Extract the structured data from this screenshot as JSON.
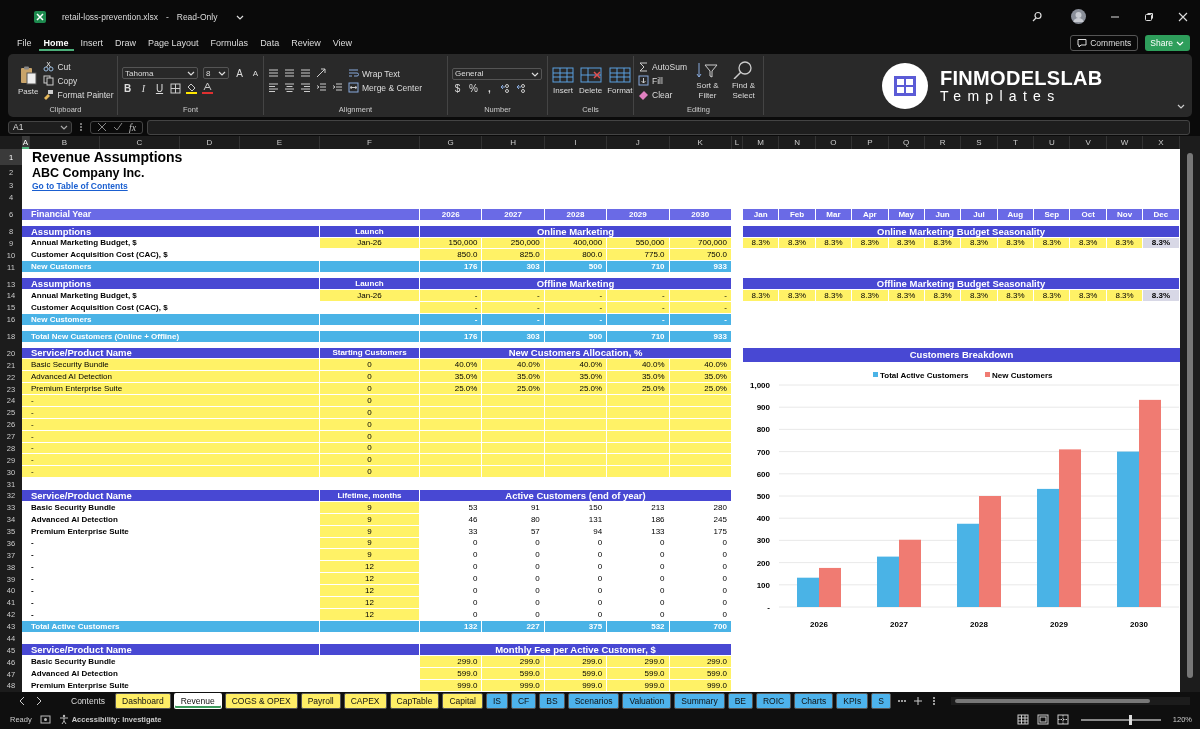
{
  "title_bar": {
    "file": "retail-loss-prevention.xlsx",
    "separator": "-",
    "status": "Read-Only"
  },
  "menu_tabs": [
    {
      "label": "File",
      "selected": false
    },
    {
      "label": "Home",
      "selected": true
    },
    {
      "label": "Insert",
      "selected": false
    },
    {
      "label": "Draw",
      "selected": false
    },
    {
      "label": "Page Layout",
      "selected": false
    },
    {
      "label": "Formulas",
      "selected": false
    },
    {
      "label": "Data",
      "selected": false
    },
    {
      "label": "Review",
      "selected": false
    },
    {
      "label": "View",
      "selected": false
    }
  ],
  "actions": {
    "comments": "Comments",
    "share": "Share"
  },
  "ribbon": {
    "clipboard": {
      "label": "Clipboard",
      "paste": "Paste",
      "cut": "Cut",
      "copy": "Copy",
      "format_painter": "Format Painter"
    },
    "font": {
      "label": "Font",
      "family": "Tahoma",
      "size": "8",
      "grow": "A",
      "shrink": "A",
      "bold": "B",
      "italic": "I",
      "underline": "U"
    },
    "alignment": {
      "label": "Alignment",
      "wrap": "Wrap Text",
      "merge": "Merge & Center"
    },
    "number": {
      "label": "Number",
      "format": "General",
      "currency": "$",
      "percent": "%",
      "comma": ","
    },
    "cells": {
      "label": "Cells",
      "insert": "Insert",
      "delete": "Delete",
      "format": "Format"
    },
    "editing": {
      "label": "Editing",
      "autosum": "AutoSum",
      "fill": "Fill",
      "clear": "Clear",
      "sort": "Sort & Filter",
      "find": "Find & Select"
    },
    "logo": {
      "name": "FINMODELSLAB",
      "tagline": "Templates"
    }
  },
  "formula_bar": {
    "name_box": "A1",
    "fx": "fx"
  },
  "columns": [
    {
      "label": "A",
      "selected": true
    },
    {
      "label": "B",
      "selected": false
    },
    {
      "label": "C",
      "selected": false
    },
    {
      "label": "D",
      "selected": false
    },
    {
      "label": "E",
      "selected": false
    },
    {
      "label": "F",
      "selected": false
    },
    {
      "label": "G",
      "selected": false
    },
    {
      "label": "H",
      "selected": false
    },
    {
      "label": "I",
      "selected": false
    },
    {
      "label": "J",
      "selected": false
    },
    {
      "label": "K",
      "selected": false
    },
    {
      "label": "L",
      "selected": false
    },
    {
      "label": "M",
      "selected": false
    },
    {
      "label": "N",
      "selected": false
    },
    {
      "label": "O",
      "selected": false
    },
    {
      "label": "P",
      "selected": false
    },
    {
      "label": "Q",
      "selected": false
    },
    {
      "label": "R",
      "selected": false
    },
    {
      "label": "S",
      "selected": false
    },
    {
      "label": "T",
      "selected": false
    },
    {
      "label": "U",
      "selected": false
    },
    {
      "label": "V",
      "selected": false
    },
    {
      "label": "W",
      "selected": false
    },
    {
      "label": "X",
      "selected": false
    }
  ],
  "rows": [
    {
      "n": "1",
      "kind": "title",
      "label": "Revenue Assumptions"
    },
    {
      "n": "2",
      "kind": "subtitle",
      "label": "ABC Company Inc."
    },
    {
      "n": "3",
      "kind": "link",
      "label": "Go to Table of Contents"
    },
    {
      "n": "4",
      "kind": "blank"
    },
    {
      "kind": "spacer"
    },
    {
      "n": "6",
      "kind": "band",
      "label": "Financial Year",
      "years": [
        "2026",
        "2027",
        "2028",
        "2029",
        "2030"
      ],
      "right": {
        "kind": "month-header",
        "values": [
          "Jan",
          "Feb",
          "Mar",
          "Apr",
          "May",
          "Jun",
          "Jul",
          "Aug",
          "Sep",
          "Oct",
          "Nov",
          "Dec"
        ]
      }
    },
    {
      "kind": "spacer"
    },
    {
      "n": "8",
      "kind": "section",
      "label": "Assumptions",
      "f": "Launch",
      "span": "Online Marketing",
      "right": {
        "kind": "header",
        "text": "Online Marketing Budget Seasonality"
      }
    },
    {
      "n": "9",
      "kind": "inputs",
      "label": "Annual Marketing Budget, $",
      "f": "Jan-26",
      "years": [
        "150,000",
        "250,000",
        "400,000",
        "550,000",
        "700,000"
      ],
      "right": {
        "kind": "seasonality",
        "inputs": [
          "8.3%",
          "8.3%",
          "8.3%",
          "8.3%",
          "8.3%",
          "8.3%",
          "8.3%",
          "8.3%",
          "8.3%",
          "8.3%",
          "8.3%"
        ],
        "balance": "8.3%"
      }
    },
    {
      "n": "10",
      "kind": "inputs",
      "label": "Customer Acquisition Cost (CAC), $",
      "years": [
        "850.0",
        "825.0",
        "800.0",
        "775.0",
        "750.0"
      ]
    },
    {
      "n": "11",
      "kind": "total",
      "label": "New Customers",
      "years": [
        "176",
        "303",
        "500",
        "710",
        "933"
      ]
    },
    {
      "kind": "spacer"
    },
    {
      "n": "13",
      "kind": "section",
      "label": "Assumptions",
      "f": "Launch",
      "span": "Offline Marketing",
      "right": {
        "kind": "header",
        "text": "Offline Marketing Budget Seasonality"
      }
    },
    {
      "n": "14",
      "kind": "inputs",
      "label": "Annual Marketing Budget, $",
      "f": "Jan-26",
      "years": [
        "-",
        "-",
        "-",
        "-",
        "-"
      ],
      "right": {
        "kind": "seasonality",
        "inputs": [
          "8.3%",
          "8.3%",
          "8.3%",
          "8.3%",
          "8.3%",
          "8.3%",
          "8.3%",
          "8.3%",
          "8.3%",
          "8.3%",
          "8.3%"
        ],
        "balance": "8.3%"
      }
    },
    {
      "n": "15",
      "kind": "inputs",
      "label": "Customer Acquisition Cost (CAC), $",
      "years": [
        "-",
        "-",
        "-",
        "-",
        "-"
      ]
    },
    {
      "n": "16",
      "kind": "total",
      "label": "New Customers",
      "years": [
        "-",
        "-",
        "-",
        "-",
        "-"
      ]
    },
    {
      "kind": "spacer"
    },
    {
      "n": "18",
      "kind": "total",
      "label": "Total New Customers (Online + Offline)",
      "years": [
        "176",
        "303",
        "500",
        "710",
        "933"
      ]
    },
    {
      "kind": "spacer"
    },
    {
      "n": "20",
      "kind": "section",
      "label": "Service/Product Name",
      "f": "Starting Customers",
      "span": "New Customers Allocation, %",
      "right": {
        "kind": "chart"
      }
    },
    {
      "n": "21",
      "kind": "allocation",
      "label": "Basic Security Bundle",
      "f": "0",
      "years": [
        "40.0%",
        "40.0%",
        "40.0%",
        "40.0%",
        "40.0%"
      ]
    },
    {
      "n": "22",
      "kind": "allocation",
      "label": "Advanced AI Detection",
      "f": "0",
      "years": [
        "35.0%",
        "35.0%",
        "35.0%",
        "35.0%",
        "35.0%"
      ]
    },
    {
      "n": "23",
      "kind": "allocation",
      "label": "Premium Enterprise Suite",
      "f": "0",
      "years": [
        "25.0%",
        "25.0%",
        "25.0%",
        "25.0%",
        "25.0%"
      ]
    },
    {
      "n": "24",
      "kind": "allocation",
      "label": "-",
      "f": "0"
    },
    {
      "n": "25",
      "kind": "allocation",
      "label": "-",
      "f": "0"
    },
    {
      "n": "26",
      "kind": "allocation",
      "label": "-",
      "f": "0"
    },
    {
      "n": "27",
      "kind": "allocation",
      "label": "-",
      "f": "0"
    },
    {
      "n": "28",
      "kind": "allocation",
      "label": "-",
      "f": "0"
    },
    {
      "n": "29",
      "kind": "allocation",
      "label": "-",
      "f": "0"
    },
    {
      "n": "30",
      "kind": "allocation",
      "label": "-",
      "f": "0"
    },
    {
      "n": "31",
      "kind": "blank"
    },
    {
      "n": "32",
      "kind": "section",
      "label": "Service/Product Name",
      "f": "Lifetime, months",
      "span": "Active Customers (end of year)"
    },
    {
      "n": "33",
      "kind": "lifetime",
      "label": "Basic Security Bundle",
      "f": "9",
      "years": [
        "53",
        "91",
        "150",
        "213",
        "280"
      ]
    },
    {
      "n": "34",
      "kind": "lifetime",
      "label": "Advanced AI Detection",
      "f": "9",
      "years": [
        "46",
        "80",
        "131",
        "186",
        "245"
      ]
    },
    {
      "n": "35",
      "kind": "lifetime",
      "label": "Premium Enterprise Suite",
      "f": "9",
      "years": [
        "33",
        "57",
        "94",
        "133",
        "175"
      ]
    },
    {
      "n": "36",
      "kind": "lifetime",
      "label": "-",
      "f": "9",
      "years": [
        "0",
        "0",
        "0",
        "0",
        "0"
      ]
    },
    {
      "n": "37",
      "kind": "lifetime",
      "label": "-",
      "f": "9",
      "years": [
        "0",
        "0",
        "0",
        "0",
        "0"
      ]
    },
    {
      "n": "38",
      "kind": "lifetime",
      "label": "-",
      "f": "12",
      "years": [
        "0",
        "0",
        "0",
        "0",
        "0"
      ]
    },
    {
      "n": "39",
      "kind": "lifetime",
      "label": "-",
      "f": "12",
      "years": [
        "0",
        "0",
        "0",
        "0",
        "0"
      ]
    },
    {
      "n": "40",
      "kind": "lifetime",
      "label": "-",
      "f": "12",
      "years": [
        "0",
        "0",
        "0",
        "0",
        "0"
      ]
    },
    {
      "n": "41",
      "kind": "lifetime",
      "label": "-",
      "f": "12",
      "years": [
        "0",
        "0",
        "0",
        "0",
        "0"
      ]
    },
    {
      "n": "42",
      "kind": "lifetime",
      "label": "-",
      "f": "12",
      "years": [
        "0",
        "0",
        "0",
        "0",
        "0"
      ]
    },
    {
      "n": "43",
      "kind": "total",
      "label": "Total Active Customers",
      "years": [
        "132",
        "227",
        "375",
        "532",
        "700"
      ]
    },
    {
      "n": "44",
      "kind": "blank"
    },
    {
      "n": "45",
      "kind": "section",
      "label": "Service/Product Name",
      "span": "Monthly Fee per Active Customer, $"
    },
    {
      "n": "46",
      "kind": "inputs",
      "label": "Basic Security Bundle",
      "years": [
        "299.0",
        "299.0",
        "299.0",
        "299.0",
        "299.0"
      ]
    },
    {
      "n": "47",
      "kind": "inputs",
      "label": "Advanced AI Detection",
      "years": [
        "599.0",
        "599.0",
        "599.0",
        "599.0",
        "599.0"
      ]
    },
    {
      "n": "48",
      "kind": "inputs",
      "label": "Premium Enterprise Suite",
      "years": [
        "999.0",
        "999.0",
        "999.0",
        "999.0",
        "999.0"
      ]
    }
  ],
  "chart": {
    "chart_data": {
      "type": "bar",
      "title": "Customers Breakdown",
      "grid": true,
      "legend": "top",
      "categories": [
        "2026",
        "2027",
        "2028",
        "2029",
        "2030"
      ],
      "series": [
        {
          "name": "Total Active Customers",
          "color": "#4ab3e6",
          "values": [
            132,
            227,
            375,
            532,
            700
          ]
        },
        {
          "name": "New Customers",
          "color": "#f07b72",
          "values": [
            176,
            303,
            500,
            710,
            933
          ]
        }
      ],
      "ylim": [
        0,
        1000
      ],
      "yticks": [
        {
          "value": 0,
          "label": "-"
        },
        100,
        200,
        300,
        400,
        500,
        600,
        700,
        800,
        900,
        {
          "value": 1000,
          "label": "1,000"
        }
      ]
    }
  },
  "sheet_tabs": [
    {
      "label": "Contents",
      "selected": false
    },
    {
      "label": "Dashboard",
      "selected": false,
      "color": "#ffee66"
    },
    {
      "label": "Revenue",
      "selected": true
    },
    {
      "label": "COGS & OPEX",
      "selected": false,
      "color": "#ffee66"
    },
    {
      "label": "Payroll",
      "selected": false,
      "color": "#ffee66"
    },
    {
      "label": "CAPEX",
      "selected": false,
      "color": "#ffee66"
    },
    {
      "label": "CapTable",
      "selected": false,
      "color": "#ffee66"
    },
    {
      "label": "Capital",
      "selected": false,
      "color": "#ffee66"
    },
    {
      "label": "IS",
      "selected": false,
      "color": "#4db3ec"
    },
    {
      "label": "CF",
      "selected": false,
      "color": "#4db3ec"
    },
    {
      "label": "BS",
      "selected": false,
      "color": "#4db3ec"
    },
    {
      "label": "Scenarios",
      "selected": false,
      "color": "#4db3ec"
    },
    {
      "label": "Valuation",
      "selected": false,
      "color": "#4db3ec"
    },
    {
      "label": "Summary",
      "selected": false,
      "color": "#4db3ec"
    },
    {
      "label": "BE",
      "selected": false,
      "color": "#4db3ec"
    },
    {
      "label": "ROIC",
      "selected": false,
      "color": "#4db3ec"
    },
    {
      "label": "Charts",
      "selected": false,
      "color": "#4db3ec"
    },
    {
      "label": "KPIs",
      "selected": false,
      "color": "#4db3ec"
    },
    {
      "label": "S",
      "selected": false,
      "color": "#4db3ec"
    }
  ],
  "status_bar": {
    "mode": "Ready",
    "accessibility": "Accessibility: Investigate",
    "zoom": "120%",
    "level": 0.62
  }
}
